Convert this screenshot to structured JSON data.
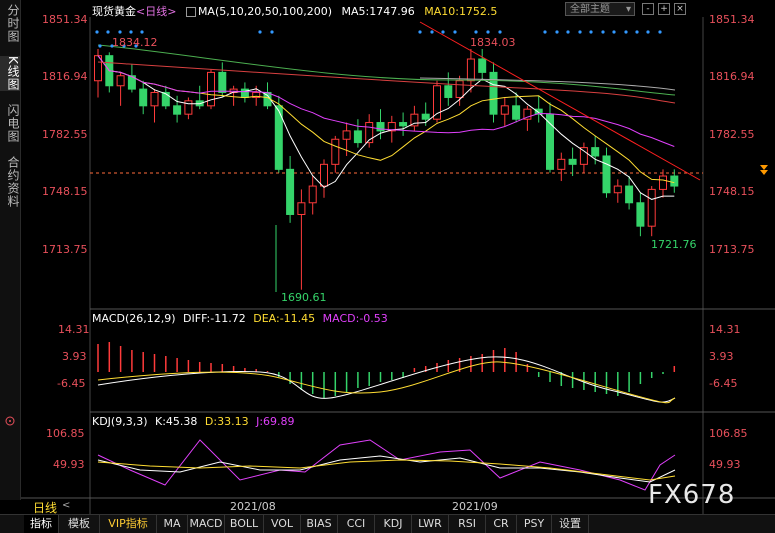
{
  "left_tabs": [
    "分时图",
    "K线图",
    "闪电图",
    "合约资料"
  ],
  "active_left_tab": "K线图",
  "header": {
    "name": "现货黄金",
    "period": "<日线>",
    "ma_label": "MA(5,10,20,50,100,200)",
    "ma5": "MA5:1747.96",
    "ma10": "MA10:1752.5",
    "theme": "全部主题",
    "btn1": "-",
    "btn2": "+",
    "btn3": "×"
  },
  "price_axis": [
    "1851.34",
    "1816.94",
    "1782.55",
    "1748.15",
    "1713.75"
  ],
  "price_annotations": {
    "high_left": "1834.12",
    "high_right": "1834.03",
    "low_mid": "1690.61",
    "low_right": "1721.76"
  },
  "macd": {
    "title": "MACD(26,12,9)",
    "diff": "DIFF:-11.72",
    "dea": "DEA:-11.45",
    "macd": "MACD:-0.53",
    "axis": [
      "14.31",
      "3.93",
      "-6.45"
    ]
  },
  "kdj": {
    "title": "KDJ(9,3,3)",
    "k": "K:45.38",
    "d": "D:33.13",
    "j": "J:69.89",
    "axis": [
      "106.85",
      "49.93"
    ]
  },
  "dates": [
    "2021/08",
    "2021/09"
  ],
  "period_label": "日线",
  "bottom_tabs": [
    "指标",
    "模板",
    "VIP指标",
    "MA",
    "MACD",
    "BOLL",
    "VOL",
    "BIAS",
    "CCI",
    "KDJ",
    "LWR",
    "RSI",
    "CR",
    "PSY",
    "设置"
  ],
  "watermark": "FX678",
  "colors": {
    "up": "#ff3b3b",
    "down": "#35d46a",
    "axis_label": "#e8505b",
    "ma5": "#ffffff",
    "ma10": "#ffdd33",
    "ma20": "#e040fb",
    "ma50": "#4caf50",
    "ma100": "#d84040",
    "ma200": "#aaaaaa"
  }
}
